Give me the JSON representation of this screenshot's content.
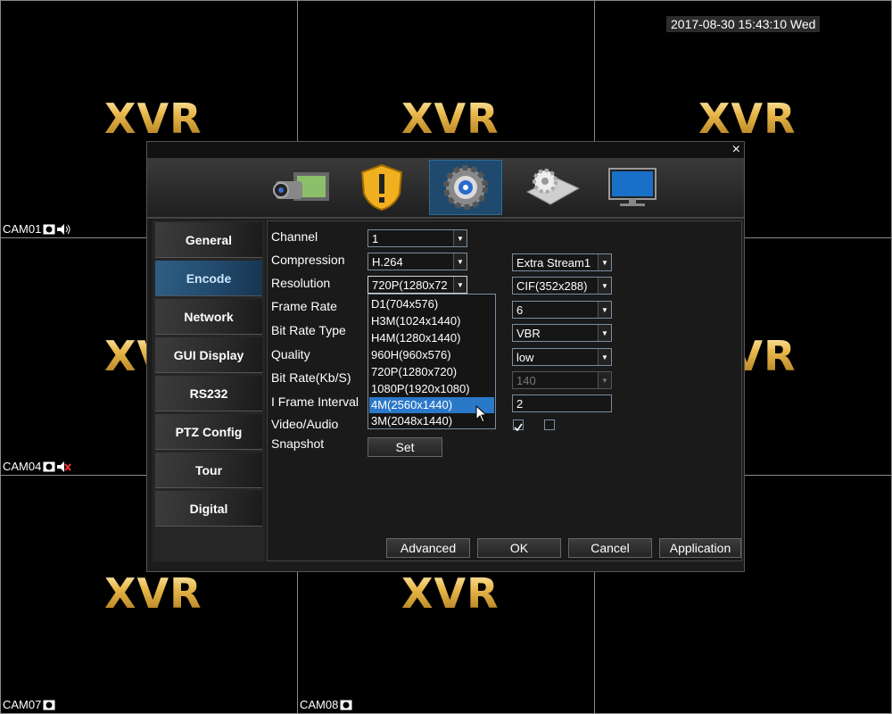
{
  "clock": "2017-08-30 15:43:10 Wed",
  "brand": "XVR",
  "cameras": {
    "cam01": "CAM01",
    "cam04": "CAM04",
    "cam07": "CAM07",
    "cam08": "CAM08"
  },
  "dialog": {
    "close": "×",
    "top_icons": [
      "record-camera-icon",
      "alarm-shield-icon",
      "system-gear-icon",
      "advanced-settings-icon",
      "monitor-icon"
    ],
    "nav": [
      "General",
      "Encode",
      "Network",
      "GUI Display",
      "RS232",
      "PTZ Config",
      "Tour",
      "Digital"
    ],
    "active_nav": "Encode",
    "labels": {
      "channel": "Channel",
      "compression": "Compression",
      "resolution": "Resolution",
      "frame_rate": "Frame Rate",
      "bit_rate_type": "Bit Rate Type",
      "quality": "Quality",
      "bit_rate": "Bit Rate(Kb/S)",
      "iframe": "I Frame Interval",
      "video_audio": "Video/Audio",
      "snapshot": "Snapshot"
    },
    "main_stream": {
      "channel": "1",
      "compression": "H.264",
      "resolution": "720P(1280x72"
    },
    "extra_stream": {
      "stream": "Extra Stream1",
      "resolution": "CIF(352x288)",
      "frame_rate": "6",
      "bit_rate_type": "VBR",
      "quality": "low",
      "bit_rate": "140",
      "iframe": "2",
      "video_checked": true,
      "audio_checked": false
    },
    "resolution_options": [
      "D1(704x576)",
      "H3M(1024x1440)",
      "H4M(1280x1440)",
      "960H(960x576)",
      "720P(1280x720)",
      "1080P(1920x1080)",
      "4M(2560x1440)",
      "3M(2048x1440)"
    ],
    "highlighted_option": "4M(2560x1440)",
    "snapshot_button": "Set",
    "buttons": {
      "advanced": "Advanced",
      "ok": "OK",
      "cancel": "Cancel",
      "apply": "Application"
    }
  }
}
